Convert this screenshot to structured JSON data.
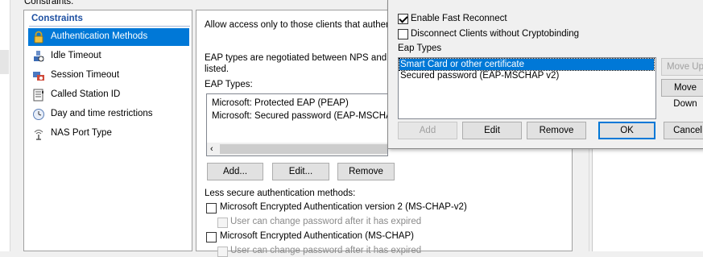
{
  "left_panel": {
    "top_label": "Constraints:",
    "header": "Constraints",
    "items": [
      {
        "label": "Authentication Methods",
        "icon": "lock-icon",
        "selected": true
      },
      {
        "label": "Idle Timeout",
        "icon": "idle-timeout-icon",
        "selected": false
      },
      {
        "label": "Session Timeout",
        "icon": "session-timeout-icon",
        "selected": false
      },
      {
        "label": "Called Station ID",
        "icon": "phone-book-icon",
        "selected": false
      },
      {
        "label": "Day and time restrictions",
        "icon": "clock-icon",
        "selected": false
      },
      {
        "label": "NAS Port Type",
        "icon": "network-port-icon",
        "selected": false
      }
    ]
  },
  "content": {
    "allow_text": "Allow access only to those clients that authentica",
    "eap_info_line1": "EAP types are negotiated between NPS and the",
    "eap_info_line2": "listed.",
    "eap_types_label": "EAP Types:",
    "eap_list": [
      "Microsoft: Protected EAP (PEAP)",
      "Microsoft: Secured password (EAP-MSCHAP v"
    ],
    "buttons": {
      "add": "Add...",
      "edit": "Edit...",
      "remove": "Remove"
    },
    "less_secure_label": "Less secure authentication methods:",
    "methods": [
      {
        "label": "Microsoft Encrypted Authentication version 2 (MS-CHAP-v2)",
        "checked": false
      },
      {
        "label": "User can change password after it has expired",
        "checked": false,
        "disabled": true
      },
      {
        "label": "Microsoft Encrypted Authentication (MS-CHAP)",
        "checked": false
      },
      {
        "label": "User can change password after it has expired",
        "checked": false,
        "disabled": true
      }
    ]
  },
  "dialog": {
    "enable_fast_reconnect": "Enable Fast Reconnect",
    "enable_fast_reconnect_checked": true,
    "disconnect_clients": "Disconnect Clients without Cryptobinding",
    "disconnect_clients_checked": false,
    "eap_types_label": "Eap Types",
    "eap_list": [
      {
        "label": "Smart Card or other certificate",
        "selected": true
      },
      {
        "label": "Secured password (EAP-MSCHAP v2)",
        "selected": false
      }
    ],
    "buttons": {
      "move_up": "Move Up",
      "move_down": "Move Down",
      "add": "Add",
      "edit": "Edit",
      "remove": "Remove",
      "ok": "OK",
      "cancel": "Cancel"
    }
  },
  "colors": {
    "selection": "#0078d7",
    "header_blue": "#1e50a2"
  }
}
